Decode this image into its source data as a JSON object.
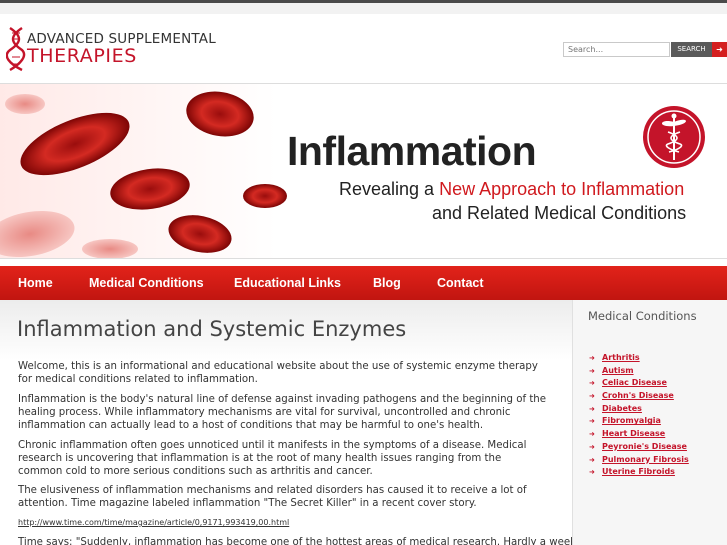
{
  "header": {
    "logo_line1": "ADVANCED SUPPLEMENTAL",
    "logo_line2": "THERAPIES",
    "search_placeholder": "Search...",
    "search_button": "SEARCH",
    "search_arrow_icon": "arrow-right-icon"
  },
  "banner": {
    "title": "Inflammation",
    "subtitle_prefix": "Revealing a ",
    "subtitle_highlight": "New Approach to Inflammation",
    "subtitle_line2": "and Related Medical Conditions",
    "emblem_icon": "caduceus-icon"
  },
  "nav": {
    "items": [
      "Home",
      "Medical Conditions",
      "Educational Links",
      "Blog",
      "Contact"
    ]
  },
  "main": {
    "title": "Inflammation and Systemic Enzymes",
    "paragraphs": [
      "Welcome, this is an informational and educational website about the use of systemic enzyme therapy for medical conditions related to inflammation.",
      "Inflammation is the body's natural line of defense against invading pathogens and the beginning of the healing process. While inflammatory mechanisms are vital for survival, uncontrolled and chronic inflammation can actually lead to a host of conditions that may be harmful to one's health.",
      "Chronic inflammation often goes unnoticed until it manifests in the symptoms of a disease. Medical research is uncovering that inflammation is at the root of many health issues ranging from the common cold to more serious conditions such as arthritis and cancer.",
      "The elusiveness of inflammation mechanisms and related disorders has caused it to receive a lot of attention. Time magazine labeled inflammation \"The Secret Killer\" in a recent cover story."
    ],
    "link": "http://www.time.com/time/magazine/article/0,9171,993419,00.html",
    "trailing": "Time says: \"Suddenly, inflammation has become one of the hottest areas of medical research. Hardly a week"
  },
  "sidebar": {
    "title": "Medical Conditions",
    "items": [
      "Arthritis",
      "Autism",
      "Celiac Disease",
      "Crohn's Disease",
      "Diabetes",
      "Fibromyalgia",
      "Heart Disease",
      "Peyronie's Disease",
      "Pulmonary Fibrosis",
      "Uterine Fibroids"
    ]
  },
  "colors": {
    "brand_red": "#c4142a",
    "nav_red": "#d41f1f"
  }
}
